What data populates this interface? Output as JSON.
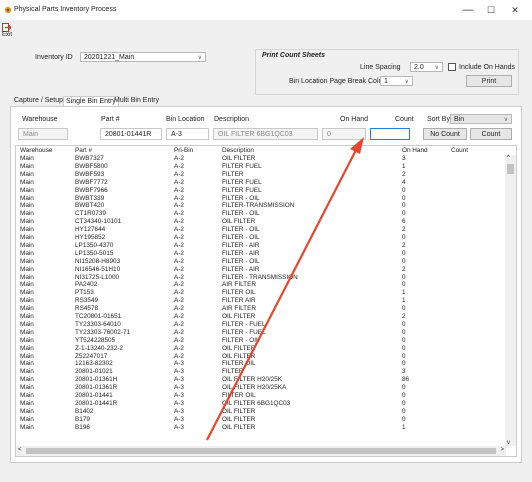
{
  "window": {
    "title": "Physical Parts Inventory Process",
    "minimize": "—",
    "maximize": "☐",
    "close": "✕"
  },
  "toolbar": {
    "exit_label": "Exit"
  },
  "inventory": {
    "label": "Inventory ID",
    "value": "20201221_Main"
  },
  "print_sheets": {
    "title": "Print Count Sheets",
    "line_spacing_label": "Line Spacing",
    "line_spacing_value": "2.0",
    "include_on_hands_label": "Include On Hands",
    "page_break_label": "Bin Location Page Break Column",
    "page_break_value": "1",
    "print_label": "Print"
  },
  "tabs": [
    "Capture / Setup",
    "Single Bin Entry",
    "Multi Bin Entry"
  ],
  "entry": {
    "headers": {
      "warehouse": "Warehouse",
      "part": "Part #",
      "bin": "Bin Location",
      "description": "Description",
      "on_hand": "On Hand",
      "count": "Count",
      "sort_by": "Sort By"
    },
    "values": {
      "warehouse": "Main",
      "part": "20801-01441R",
      "bin": "A-3",
      "description": "OIL FILTER 6BG1QC03",
      "on_hand": "0",
      "count": ""
    },
    "sort_by_value": "Bin",
    "no_count_label": "No Count",
    "count_button_label": "Count"
  },
  "grid": {
    "columns": [
      "Warehouse",
      "Part #",
      "Pri-Bin",
      "Description",
      "On Hand",
      "Count"
    ],
    "selected_index": 40,
    "rows": [
      [
        "Main",
        "BWB7327",
        "A-2",
        "OIL FILTER",
        "3",
        ""
      ],
      [
        "Main",
        "BWBF5800",
        "A-2",
        "FILTER FUEL",
        "1",
        ""
      ],
      [
        "Main",
        "BWBF593",
        "A-2",
        "FILTER",
        "2",
        ""
      ],
      [
        "Main",
        "BWBF7772",
        "A-2",
        "FILTER FUEL",
        "4",
        ""
      ],
      [
        "Main",
        "BWBF7966",
        "A-2",
        "FILTER FUEL",
        "0",
        ""
      ],
      [
        "Main",
        "BWBT339",
        "A-2",
        "FILTER - OIL",
        "0",
        ""
      ],
      [
        "Main",
        "BWBT420",
        "A-2",
        "FILTER-TRANSMISSION",
        "0",
        ""
      ],
      [
        "Main",
        "CT1R0739",
        "A-2",
        "FILTER - OIL",
        "0",
        ""
      ],
      [
        "Main",
        "CT34340-10101",
        "A-2",
        "OIL FILTER",
        "6",
        ""
      ],
      [
        "Main",
        "HY127644",
        "A-2",
        "FILTER - OIL",
        "2",
        ""
      ],
      [
        "Main",
        "HY195852",
        "A-2",
        "FILTER - OIL",
        "0",
        ""
      ],
      [
        "Main",
        "LP1350-4370",
        "A-2",
        "FILTER - AIR",
        "2",
        ""
      ],
      [
        "Main",
        "LP1350-5015",
        "A-2",
        "FILTER - AIR",
        "0",
        ""
      ],
      [
        "Main",
        "NI15208-H8903",
        "A-2",
        "FILTER - OIL",
        "0",
        ""
      ],
      [
        "Main",
        "NI16546-51H10",
        "A-2",
        "FILTER - AIR",
        "2",
        ""
      ],
      [
        "Main",
        "NI31725-L1000",
        "A-2",
        "FILTER - TRANSMISSION",
        "0",
        ""
      ],
      [
        "Main",
        "PA2402",
        "A-2",
        "AIR FILTER",
        "0",
        ""
      ],
      [
        "Main",
        "PT153",
        "A-2",
        "FILTER OIL",
        "1",
        ""
      ],
      [
        "Main",
        "RS3549",
        "A-2",
        "FILTER AIR",
        "1",
        ""
      ],
      [
        "Main",
        "RS4578",
        "A-2",
        "AIR FILTER",
        "0",
        ""
      ],
      [
        "Main",
        "TC20801-01651",
        "A-2",
        "OIL FILTER",
        "2",
        ""
      ],
      [
        "Main",
        "TY23303-64010",
        "A-2",
        "FILTER - FUEL",
        "0",
        ""
      ],
      [
        "Main",
        "TY23303-76002-71",
        "A-2",
        "FILTER - FUEL",
        "0",
        ""
      ],
      [
        "Main",
        "YT524228505",
        "A-2",
        "FILTER - OIL",
        "0",
        ""
      ],
      [
        "Main",
        "Z-1-13240-232-2",
        "A-2",
        "OIL FILTER",
        "0",
        ""
      ],
      [
        "Main",
        "Z52247017",
        "A-2",
        "OIL FILTER",
        "0",
        ""
      ],
      [
        "Main",
        "12163-82302",
        "A-3",
        "FILTER OIL",
        "0",
        ""
      ],
      [
        "Main",
        "20801-01021",
        "A-3",
        "FILTER",
        "3",
        ""
      ],
      [
        "Main",
        "20801-01361H",
        "A-3",
        "OIL FILTER H20/25K",
        "86",
        ""
      ],
      [
        "Main",
        "20801-01361R",
        "A-3",
        "OIL FILTER H20/25KA",
        "0",
        ""
      ],
      [
        "Main",
        "20801-01441",
        "A-3",
        "FILTER OIL",
        "0",
        ""
      ],
      [
        "Main",
        "20801-01441R",
        "A-3",
        "OIL FILTER 6BG1QC03",
        "0",
        ""
      ],
      [
        "Main",
        "B1402",
        "A-3",
        "OIL FILTER",
        "0",
        ""
      ],
      [
        "Main",
        "B179",
        "A-3",
        "OIL FILTER",
        "0",
        ""
      ],
      [
        "Main",
        "B196",
        "A-3",
        "OIL FILTER",
        "1",
        ""
      ]
    ]
  },
  "colors": {
    "arrow": "#e8462a",
    "selected_row": "#d7d3cb",
    "focus_border": "#2b7cd3"
  }
}
